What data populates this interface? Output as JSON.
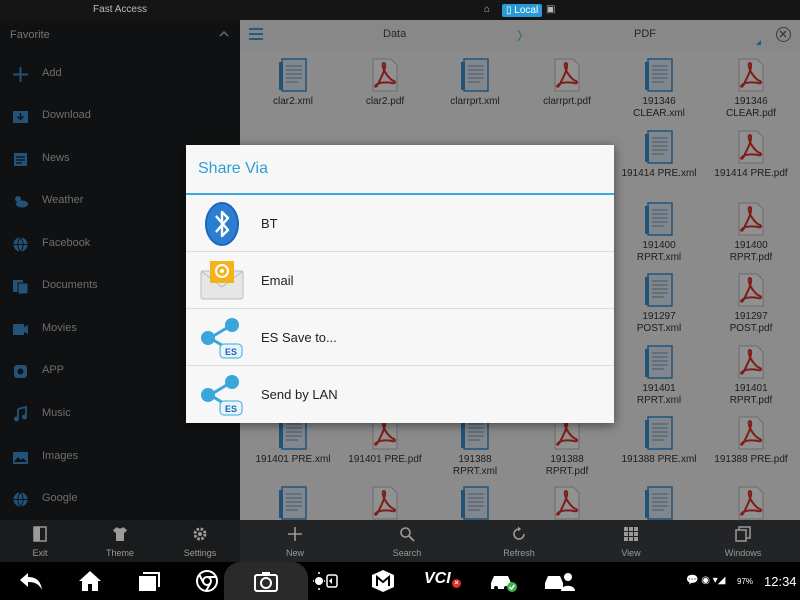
{
  "topbar": {
    "title": "Fast Access",
    "location_badge": "Local"
  },
  "sidebar": {
    "header": "Favorite",
    "items": [
      {
        "label": "Add",
        "icon": "plus-icon"
      },
      {
        "label": "Download",
        "icon": "download-icon"
      },
      {
        "label": "News",
        "icon": "news-icon"
      },
      {
        "label": "Weather",
        "icon": "weather-icon"
      },
      {
        "label": "Facebook",
        "icon": "globe-icon"
      },
      {
        "label": "Documents",
        "icon": "documents-icon"
      },
      {
        "label": "Movies",
        "icon": "movies-icon"
      },
      {
        "label": "APP",
        "icon": "app-icon"
      },
      {
        "label": "Music",
        "icon": "music-icon"
      },
      {
        "label": "Images",
        "icon": "images-icon"
      },
      {
        "label": "Google",
        "icon": "globe-icon"
      }
    ]
  },
  "main": {
    "breadcrumb": {
      "first": "Data",
      "separator": "〉",
      "second": "PDF"
    },
    "files": [
      {
        "name": "clar2.xml",
        "type": "xml"
      },
      {
        "name": "clar2.pdf",
        "type": "pdf"
      },
      {
        "name": "clarrprt.xml",
        "type": "xml"
      },
      {
        "name": "clarrprt.pdf",
        "type": "pdf"
      },
      {
        "name": "191346\nCLEAR.xml",
        "type": "xml"
      },
      {
        "name": "191346\nCLEAR.pdf",
        "type": "pdf"
      },
      {
        "name": "191414 PRE.xml",
        "type": "xml"
      },
      {
        "name": "191414 PRE.pdf",
        "type": "pdf"
      },
      {
        "name": "191400\nRPRT.xml",
        "type": "xml"
      },
      {
        "name": "191400\nRPRT.pdf",
        "type": "pdf"
      },
      {
        "name": "191297\nPOST.xml",
        "type": "xml"
      },
      {
        "name": "191297\nPOST.pdf",
        "type": "pdf"
      },
      {
        "name": "191401\nRPRT.xml",
        "type": "xml"
      },
      {
        "name": "191401\nRPRT.pdf",
        "type": "pdf"
      },
      {
        "name": "191401 PRE.xml",
        "type": "xml"
      },
      {
        "name": "191401 PRE.pdf",
        "type": "pdf"
      },
      {
        "name": "191388\nRPRT.xml",
        "type": "xml"
      },
      {
        "name": "191388\nRPRT.pdf",
        "type": "pdf"
      },
      {
        "name": "191388 PRE.xml",
        "type": "xml"
      },
      {
        "name": "191388 PRE.pdf",
        "type": "pdf"
      }
    ]
  },
  "dialog": {
    "title": "Share Via",
    "options": [
      {
        "label": "BT",
        "icon": "bluetooth-icon"
      },
      {
        "label": "Email",
        "icon": "email-icon"
      },
      {
        "label": "ES Save to...",
        "icon": "es-share-icon"
      },
      {
        "label": "Send by LAN",
        "icon": "es-share-icon"
      }
    ]
  },
  "toolbar": {
    "items": [
      {
        "label": "Exit",
        "icon": "exit-icon"
      },
      {
        "label": "Theme",
        "icon": "theme-shirt-icon"
      },
      {
        "label": "Settings",
        "icon": "gear-icon"
      },
      {
        "label": "New",
        "icon": "plus-icon"
      },
      {
        "label": "Search",
        "icon": "search-icon"
      },
      {
        "label": "Refresh",
        "icon": "refresh-icon"
      },
      {
        "label": "View",
        "icon": "grid-view-icon"
      },
      {
        "label": "Windows",
        "icon": "windows-icon"
      }
    ]
  },
  "statusbar": {
    "battery": "97%",
    "time": "12:34",
    "vci_label": "VCI"
  },
  "colors": {
    "accent": "#2f9ed6",
    "pdf_red": "#d9322c",
    "xml_blue": "#3a8fd0"
  }
}
